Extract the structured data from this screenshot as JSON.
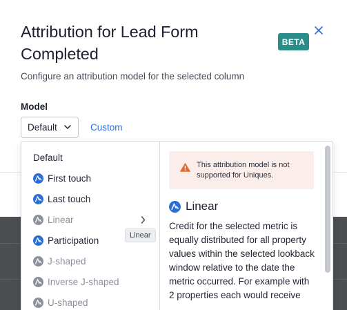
{
  "header": {
    "title": "Attribution for Lead Form Completed",
    "badge": "BETA",
    "subtitle": "Configure an attribution model for the selected column"
  },
  "model": {
    "label": "Model",
    "selected": "Default",
    "custom_link": "Custom"
  },
  "menu": {
    "items": [
      {
        "label": "Default",
        "icon": "none",
        "enabled": true
      },
      {
        "label": "First touch",
        "icon": "attribution-icon",
        "enabled": true
      },
      {
        "label": "Last touch",
        "icon": "attribution-icon",
        "enabled": true
      },
      {
        "label": "Linear",
        "icon": "attribution-icon",
        "enabled": false,
        "has_submenu": true
      },
      {
        "label": "Participation",
        "icon": "attribution-icon",
        "enabled": true
      },
      {
        "label": "J-shaped",
        "icon": "attribution-icon",
        "enabled": false
      },
      {
        "label": "Inverse J-shaped",
        "icon": "attribution-icon",
        "enabled": false
      },
      {
        "label": "U-shaped",
        "icon": "attribution-icon",
        "enabled": false
      }
    ]
  },
  "tooltip": "Linear",
  "detail": {
    "warning": "This attribution model is not supported for Uniques.",
    "title": "Linear",
    "body": "Credit for the selected metric is equally distributed for all property values within the selected lookback window relative to the date the metric occurred. For example with 2 properties each would receive"
  },
  "colors": {
    "accent": "#2b6ed8",
    "badge": "#2a8d8a",
    "warning_bg": "#fbeeea",
    "warning_icon": "#e36a2e"
  }
}
